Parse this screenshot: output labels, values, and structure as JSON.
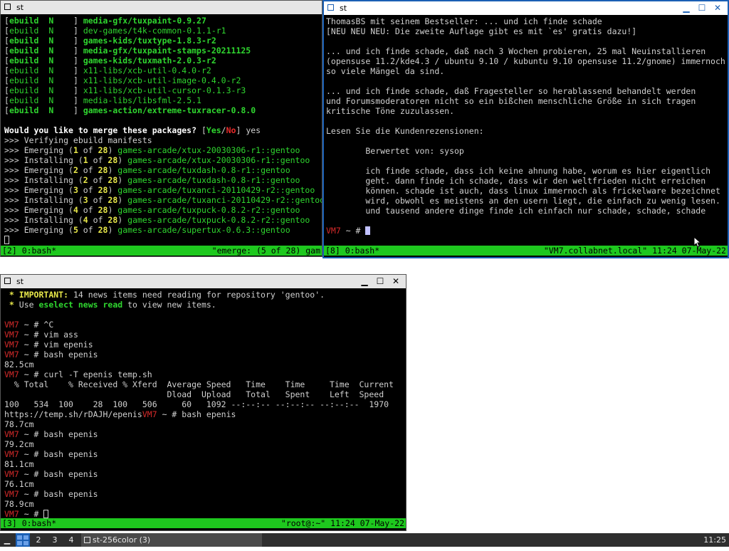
{
  "window_top_left": {
    "title": "st",
    "lines": [
      [
        [
          "[",
          "w0"
        ],
        [
          "ebuild  ",
          "gb"
        ],
        [
          "N",
          "gb"
        ],
        [
          "    ] ",
          "w0"
        ],
        [
          "media-gfx/tuxpaint-0.9.27",
          "gb"
        ]
      ],
      [
        [
          "[",
          "w0"
        ],
        [
          "ebuild  ",
          "gdim"
        ],
        [
          "N",
          "gdim"
        ],
        [
          "    ] ",
          "w0"
        ],
        [
          "dev-games/t4k-common-0.1.1-r1",
          "gdim"
        ]
      ],
      [
        [
          "[",
          "w0"
        ],
        [
          "ebuild  ",
          "gb"
        ],
        [
          "N",
          "gb"
        ],
        [
          "    ] ",
          "w0"
        ],
        [
          "games-kids/tuxtype-1.8.3-r2",
          "gb"
        ]
      ],
      [
        [
          "[",
          "w0"
        ],
        [
          "ebuild  ",
          "gb"
        ],
        [
          "N",
          "gb"
        ],
        [
          "    ] ",
          "w0"
        ],
        [
          "media-gfx/tuxpaint-stamps-20211125",
          "gb"
        ]
      ],
      [
        [
          "[",
          "w0"
        ],
        [
          "ebuild  ",
          "gb"
        ],
        [
          "N",
          "gb"
        ],
        [
          "    ] ",
          "w0"
        ],
        [
          "games-kids/tuxmath-2.0.3-r2",
          "gb"
        ]
      ],
      [
        [
          "[",
          "w0"
        ],
        [
          "ebuild  ",
          "gdim"
        ],
        [
          "N",
          "gdim"
        ],
        [
          "    ] ",
          "w0"
        ],
        [
          "x11-libs/xcb-util-0.4.0-r2",
          "gdim"
        ]
      ],
      [
        [
          "[",
          "w0"
        ],
        [
          "ebuild  ",
          "gdim"
        ],
        [
          "N",
          "gdim"
        ],
        [
          "    ] ",
          "w0"
        ],
        [
          "x11-libs/xcb-util-image-0.4.0-r2",
          "gdim"
        ]
      ],
      [
        [
          "[",
          "w0"
        ],
        [
          "ebuild  ",
          "gdim"
        ],
        [
          "N",
          "gdim"
        ],
        [
          "    ] ",
          "w0"
        ],
        [
          "x11-libs/xcb-util-cursor-0.1.3-r3",
          "gdim"
        ]
      ],
      [
        [
          "[",
          "w0"
        ],
        [
          "ebuild  ",
          "gdim"
        ],
        [
          "N",
          "gdim"
        ],
        [
          "    ] ",
          "w0"
        ],
        [
          "media-libs/libsfml-2.5.1",
          "gdim"
        ]
      ],
      [
        [
          "[",
          "w0"
        ],
        [
          "ebuild  ",
          "gb"
        ],
        [
          "N",
          "gb"
        ],
        [
          "    ] ",
          "w0"
        ],
        [
          "games-action/extreme-tuxracer-0.8.0",
          "gb"
        ]
      ],
      [],
      [
        [
          "Would you like to merge these packages? ",
          "w"
        ],
        [
          "[",
          "w0"
        ],
        [
          "Yes",
          "gb"
        ],
        [
          "/",
          "w0"
        ],
        [
          "No",
          "r"
        ],
        [
          "] yes",
          "w0"
        ]
      ],
      [
        [
          ">>> Verifying ebuild manifests",
          "w0"
        ]
      ],
      [
        [
          ">>> Emerging (",
          "w0"
        ],
        [
          "1",
          "y"
        ],
        [
          " of ",
          "w0"
        ],
        [
          "28",
          "y"
        ],
        [
          ") ",
          "w0"
        ],
        [
          "games-arcade/xtux-20030306-r1::gentoo",
          "gdim"
        ]
      ],
      [
        [
          ">>> Installing (",
          "w0"
        ],
        [
          "1",
          "y"
        ],
        [
          " of ",
          "w0"
        ],
        [
          "28",
          "y"
        ],
        [
          ") ",
          "w0"
        ],
        [
          "games-arcade/xtux-20030306-r1::gentoo",
          "gdim"
        ]
      ],
      [
        [
          ">>> Emerging (",
          "w0"
        ],
        [
          "2",
          "y"
        ],
        [
          " of ",
          "w0"
        ],
        [
          "28",
          "y"
        ],
        [
          ") ",
          "w0"
        ],
        [
          "games-arcade/tuxdash-0.8-r1::gentoo",
          "gdim"
        ]
      ],
      [
        [
          ">>> Installing (",
          "w0"
        ],
        [
          "2",
          "y"
        ],
        [
          " of ",
          "w0"
        ],
        [
          "28",
          "y"
        ],
        [
          ") ",
          "w0"
        ],
        [
          "games-arcade/tuxdash-0.8-r1::gentoo",
          "gdim"
        ]
      ],
      [
        [
          ">>> Emerging (",
          "w0"
        ],
        [
          "3",
          "y"
        ],
        [
          " of ",
          "w0"
        ],
        [
          "28",
          "y"
        ],
        [
          ") ",
          "w0"
        ],
        [
          "games-arcade/tuxanci-20110429-r2::gentoo",
          "gdim"
        ]
      ],
      [
        [
          ">>> Installing (",
          "w0"
        ],
        [
          "3",
          "y"
        ],
        [
          " of ",
          "w0"
        ],
        [
          "28",
          "y"
        ],
        [
          ") ",
          "w0"
        ],
        [
          "games-arcade/tuxanci-20110429-r2::gentoo",
          "gdim"
        ]
      ],
      [
        [
          ">>> Emerging (",
          "w0"
        ],
        [
          "4",
          "y"
        ],
        [
          " of ",
          "w0"
        ],
        [
          "28",
          "y"
        ],
        [
          ") ",
          "w0"
        ],
        [
          "games-arcade/tuxpuck-0.8.2-r2::gentoo",
          "gdim"
        ]
      ],
      [
        [
          ">>> Installing (",
          "w0"
        ],
        [
          "4",
          "y"
        ],
        [
          " of ",
          "w0"
        ],
        [
          "28",
          "y"
        ],
        [
          ") ",
          "w0"
        ],
        [
          "games-arcade/tuxpuck-0.8.2-r2::gentoo",
          "gdim"
        ]
      ],
      [
        [
          ">>> Emerging (",
          "w0"
        ],
        [
          "5",
          "y"
        ],
        [
          " of ",
          "w0"
        ],
        [
          "28",
          "y"
        ],
        [
          ") ",
          "w0"
        ],
        [
          "games-arcade/supertux-0.6.3::gentoo",
          "gdim"
        ]
      ]
    ],
    "status_left": "[2] 0:bash*",
    "status_right": "\"emerge: (5 of 28) gam"
  },
  "window_top_right": {
    "title": "st",
    "lines": [
      "ThomasBS mit seinem Bestseller: ... und ich finde schade",
      "[NEU NEU NEU: Die zweite Auflage gibt es mit `es' gratis dazu!]",
      "",
      "... und ich finde schade, daß nach 3 Wochen probieren, 25 mal Neuinstallieren",
      "(opensuse 11.2/kde4.3 / ubuntu 9.10 / kubuntu 9.10 opensuse 11.2/gnome) immernoch",
      "so viele Mängel da sind.",
      "",
      "... und ich finde schade, daß Fragesteller so herablassend behandelt werden",
      "und Forumsmoderatoren nicht so ein bißchen menschliche Größe in sich tragen",
      "kritische Töne zuzulassen.",
      "",
      "Lesen Sie die Kundenrezensionen:",
      "",
      "        Berwertet von: sysop",
      "",
      "        ich finde schade, dass ich keine ahnung habe, worum es hier eigentlich",
      "        geht. dann finde ich schade, dass wir den weltfrieden nicht erreichen",
      "        können. schade ist auch, dass linux immernoch als frickelware bezeichnet",
      "        wird, obwohl es meistens an den usern liegt, die einfach zu wenig lesen.",
      "        und tausend andere dinge finde ich einfach nur schade, schade, schade"
    ],
    "prompt_host": "VM7",
    "prompt_rest": " ~ # ",
    "status_left": "[8] 0:bash*",
    "status_right": "\"VM7.collabnet.local\" 11:24 07-May-22"
  },
  "window_bottom": {
    "title": "st",
    "lines": [
      [
        [
          " * ",
          "y"
        ],
        [
          "IMPORTANT:",
          "y"
        ],
        [
          " 14 news items need reading for repository 'gentoo'.",
          "w0"
        ]
      ],
      [
        [
          " * ",
          "y"
        ],
        [
          "Use ",
          "w0"
        ],
        [
          "eselect news read",
          "gb"
        ],
        [
          " to view new items.",
          "w0"
        ]
      ],
      [],
      [
        [
          "VM7",
          "p"
        ],
        [
          " ~ # ^C",
          "w0"
        ]
      ],
      [
        [
          "VM7",
          "p"
        ],
        [
          " ~ # vim ass",
          "w0"
        ]
      ],
      [
        [
          "VM7",
          "p"
        ],
        [
          " ~ # vim epenis",
          "w0"
        ]
      ],
      [
        [
          "VM7",
          "p"
        ],
        [
          " ~ # bash epenis",
          "w0"
        ]
      ],
      [
        [
          "82.5cm",
          "w0"
        ]
      ],
      [
        [
          "VM7",
          "p"
        ],
        [
          " ~ # curl -T epenis temp.sh",
          "w0"
        ]
      ],
      [
        [
          "  % Total    % Received % Xferd  Average Speed   Time    Time     Time  Current",
          "w0"
        ]
      ],
      [
        [
          "                                 Dload  Upload   Total   Spent    Left  Speed",
          "w0"
        ]
      ],
      [
        [
          "100   534  100    28  100   506     60   1092 --:--:-- --:--:-- --:--:--  1970",
          "w0"
        ]
      ],
      [
        [
          "https://temp.sh/rDAJH/epenis",
          "w0"
        ],
        [
          "VM7",
          "p"
        ],
        [
          " ~ # bash epenis",
          "w0"
        ]
      ],
      [
        [
          "78.7cm",
          "w0"
        ]
      ],
      [
        [
          "VM7",
          "p"
        ],
        [
          " ~ # bash epenis",
          "w0"
        ]
      ],
      [
        [
          "79.2cm",
          "w0"
        ]
      ],
      [
        [
          "VM7",
          "p"
        ],
        [
          " ~ # bash epenis",
          "w0"
        ]
      ],
      [
        [
          "81.1cm",
          "w0"
        ]
      ],
      [
        [
          "VM7",
          "p"
        ],
        [
          " ~ # bash epenis",
          "w0"
        ]
      ],
      [
        [
          "76.1cm",
          "w0"
        ]
      ],
      [
        [
          "VM7",
          "p"
        ],
        [
          " ~ # bash epenis",
          "w0"
        ]
      ],
      [
        [
          "78.9cm",
          "w0"
        ]
      ]
    ],
    "prompt_host": "VM7",
    "prompt_rest": " ~ # ",
    "status_left": "[3] 0:bash*",
    "status_right": "\"root@:~\" 11:24 07-May-22"
  },
  "taskbar": {
    "workspaces": [
      "1",
      "2",
      "3",
      "4"
    ],
    "task_label": "st-256color (3)",
    "clock": "11:25"
  },
  "colors": {
    "status_green": "#1ec81e",
    "prompt_red": "#d62a2a",
    "accent_blue": "#1a5fb4",
    "taskbar_bg": "#2e2e2e"
  },
  "window_buttons": {
    "minimize": "▁",
    "maximize": "☐",
    "close": "✕"
  }
}
